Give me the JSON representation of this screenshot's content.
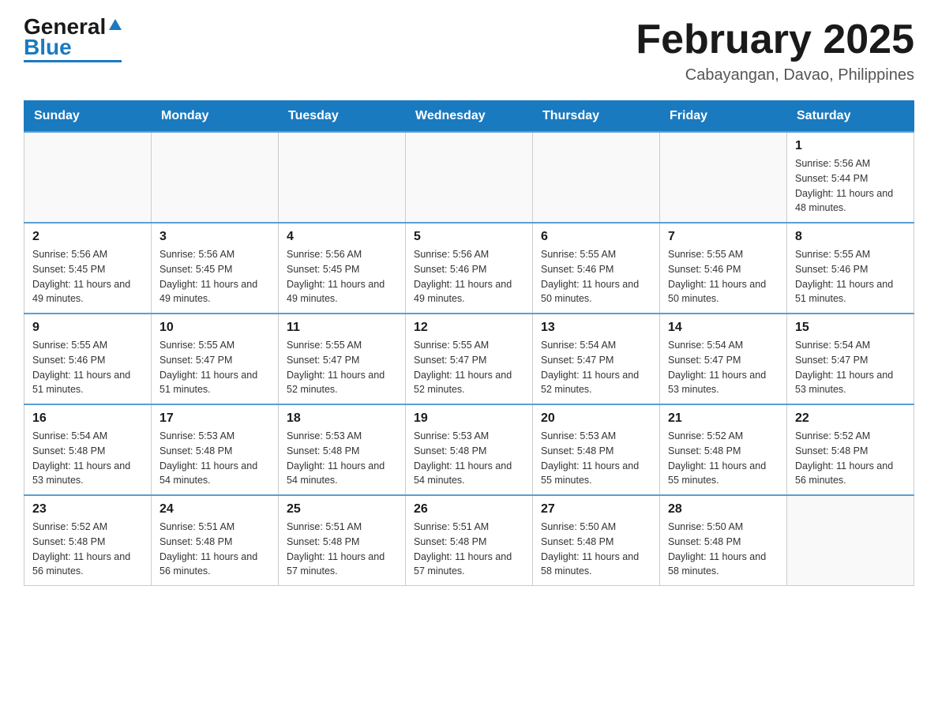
{
  "header": {
    "logo": {
      "general": "General",
      "blue": "Blue",
      "tagline": ""
    },
    "title": "February 2025",
    "location": "Cabayangan, Davao, Philippines"
  },
  "calendar": {
    "days_of_week": [
      "Sunday",
      "Monday",
      "Tuesday",
      "Wednesday",
      "Thursday",
      "Friday",
      "Saturday"
    ],
    "weeks": [
      [
        {
          "day": "",
          "info": ""
        },
        {
          "day": "",
          "info": ""
        },
        {
          "day": "",
          "info": ""
        },
        {
          "day": "",
          "info": ""
        },
        {
          "day": "",
          "info": ""
        },
        {
          "day": "",
          "info": ""
        },
        {
          "day": "1",
          "info": "Sunrise: 5:56 AM\nSunset: 5:44 PM\nDaylight: 11 hours and 48 minutes."
        }
      ],
      [
        {
          "day": "2",
          "info": "Sunrise: 5:56 AM\nSunset: 5:45 PM\nDaylight: 11 hours and 49 minutes."
        },
        {
          "day": "3",
          "info": "Sunrise: 5:56 AM\nSunset: 5:45 PM\nDaylight: 11 hours and 49 minutes."
        },
        {
          "day": "4",
          "info": "Sunrise: 5:56 AM\nSunset: 5:45 PM\nDaylight: 11 hours and 49 minutes."
        },
        {
          "day": "5",
          "info": "Sunrise: 5:56 AM\nSunset: 5:46 PM\nDaylight: 11 hours and 49 minutes."
        },
        {
          "day": "6",
          "info": "Sunrise: 5:55 AM\nSunset: 5:46 PM\nDaylight: 11 hours and 50 minutes."
        },
        {
          "day": "7",
          "info": "Sunrise: 5:55 AM\nSunset: 5:46 PM\nDaylight: 11 hours and 50 minutes."
        },
        {
          "day": "8",
          "info": "Sunrise: 5:55 AM\nSunset: 5:46 PM\nDaylight: 11 hours and 51 minutes."
        }
      ],
      [
        {
          "day": "9",
          "info": "Sunrise: 5:55 AM\nSunset: 5:46 PM\nDaylight: 11 hours and 51 minutes."
        },
        {
          "day": "10",
          "info": "Sunrise: 5:55 AM\nSunset: 5:47 PM\nDaylight: 11 hours and 51 minutes."
        },
        {
          "day": "11",
          "info": "Sunrise: 5:55 AM\nSunset: 5:47 PM\nDaylight: 11 hours and 52 minutes."
        },
        {
          "day": "12",
          "info": "Sunrise: 5:55 AM\nSunset: 5:47 PM\nDaylight: 11 hours and 52 minutes."
        },
        {
          "day": "13",
          "info": "Sunrise: 5:54 AM\nSunset: 5:47 PM\nDaylight: 11 hours and 52 minutes."
        },
        {
          "day": "14",
          "info": "Sunrise: 5:54 AM\nSunset: 5:47 PM\nDaylight: 11 hours and 53 minutes."
        },
        {
          "day": "15",
          "info": "Sunrise: 5:54 AM\nSunset: 5:47 PM\nDaylight: 11 hours and 53 minutes."
        }
      ],
      [
        {
          "day": "16",
          "info": "Sunrise: 5:54 AM\nSunset: 5:48 PM\nDaylight: 11 hours and 53 minutes."
        },
        {
          "day": "17",
          "info": "Sunrise: 5:53 AM\nSunset: 5:48 PM\nDaylight: 11 hours and 54 minutes."
        },
        {
          "day": "18",
          "info": "Sunrise: 5:53 AM\nSunset: 5:48 PM\nDaylight: 11 hours and 54 minutes."
        },
        {
          "day": "19",
          "info": "Sunrise: 5:53 AM\nSunset: 5:48 PM\nDaylight: 11 hours and 54 minutes."
        },
        {
          "day": "20",
          "info": "Sunrise: 5:53 AM\nSunset: 5:48 PM\nDaylight: 11 hours and 55 minutes."
        },
        {
          "day": "21",
          "info": "Sunrise: 5:52 AM\nSunset: 5:48 PM\nDaylight: 11 hours and 55 minutes."
        },
        {
          "day": "22",
          "info": "Sunrise: 5:52 AM\nSunset: 5:48 PM\nDaylight: 11 hours and 56 minutes."
        }
      ],
      [
        {
          "day": "23",
          "info": "Sunrise: 5:52 AM\nSunset: 5:48 PM\nDaylight: 11 hours and 56 minutes."
        },
        {
          "day": "24",
          "info": "Sunrise: 5:51 AM\nSunset: 5:48 PM\nDaylight: 11 hours and 56 minutes."
        },
        {
          "day": "25",
          "info": "Sunrise: 5:51 AM\nSunset: 5:48 PM\nDaylight: 11 hours and 57 minutes."
        },
        {
          "day": "26",
          "info": "Sunrise: 5:51 AM\nSunset: 5:48 PM\nDaylight: 11 hours and 57 minutes."
        },
        {
          "day": "27",
          "info": "Sunrise: 5:50 AM\nSunset: 5:48 PM\nDaylight: 11 hours and 58 minutes."
        },
        {
          "day": "28",
          "info": "Sunrise: 5:50 AM\nSunset: 5:48 PM\nDaylight: 11 hours and 58 minutes."
        },
        {
          "day": "",
          "info": ""
        }
      ]
    ]
  }
}
